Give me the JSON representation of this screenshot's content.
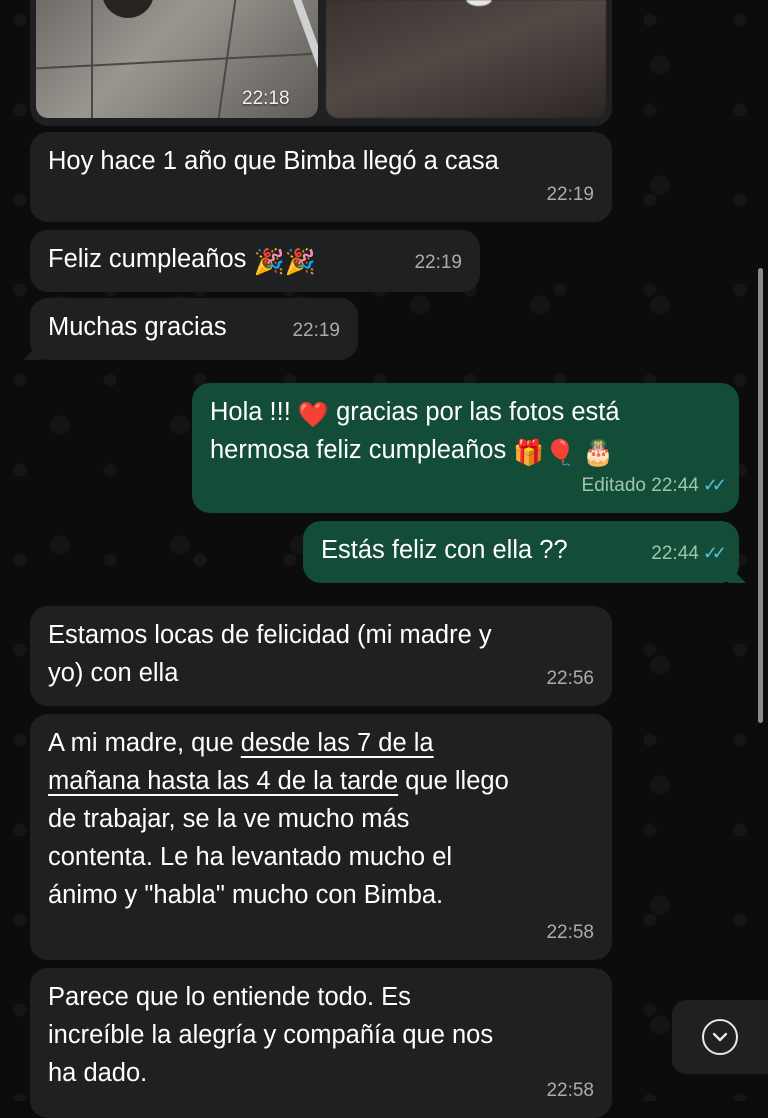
{
  "chat": {
    "media": {
      "time": "22:18"
    },
    "messages": [
      {
        "id": "m1",
        "dir": "in",
        "text": "Hoy hace 1 año que Bimba llegó a casa",
        "time": "22:19"
      },
      {
        "id": "m2",
        "dir": "in",
        "text": "Feliz cumpleaños",
        "emoji": "🎉🎉",
        "time": "22:19"
      },
      {
        "id": "m3",
        "dir": "in",
        "text": "Muchas gracias",
        "time": "22:19"
      },
      {
        "id": "m4",
        "dir": "out",
        "text_a": "Hola !!! ",
        "emoji_a": "❤️",
        "text_b": " gracias por las fotos está",
        "text_c": "hermosa feliz cumpleaños ",
        "emoji_b": "🎁🎈 🎂",
        "edited_label": "Editado",
        "time": "22:44",
        "status": "read"
      },
      {
        "id": "m5",
        "dir": "out",
        "text": "Estás feliz con ella ??",
        "time": "22:44",
        "status": "read"
      },
      {
        "id": "m6",
        "dir": "in",
        "line1": "Estamos locas de felicidad (mi madre y",
        "line2": "yo) con ella",
        "time": "22:56"
      },
      {
        "id": "m7",
        "dir": "in",
        "line1_a": "A mi madre, que ",
        "line1_b": "desde las 7 de la",
        "line2_a": "mañana hasta las 4 de la tarde",
        "line2_b": " que llego",
        "line3": "de trabajar, se la ve mucho más",
        "line4": "contenta. Le ha levantado mucho el",
        "line5": "ánimo y \"habla\" mucho con Bimba.",
        "time": "22:58"
      },
      {
        "id": "m8",
        "dir": "in",
        "line1": "Parece que lo entiende todo. Es",
        "line2": "increíble la alegría y compañía que nos",
        "line3": "ha dado.",
        "time": "22:58"
      }
    ],
    "read_ticks": "✓✓",
    "scroll_down_icon": "⌄"
  },
  "colors": {
    "incoming_bubble": "#1f2022",
    "outgoing_bubble": "#134d37",
    "read_tick": "#53bdeb"
  }
}
